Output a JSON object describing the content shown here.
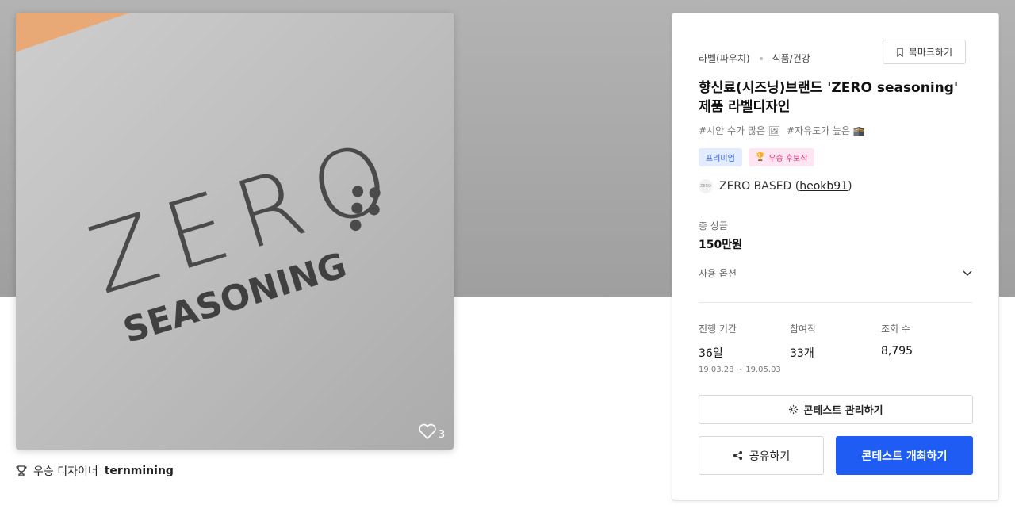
{
  "hero": {
    "logo_word": "ZERO",
    "logo_sub": "SEASONING",
    "likes": "3"
  },
  "winner": {
    "prefix": "우승 디자이너",
    "name": "ternmining"
  },
  "panel": {
    "category": "라벨(파우치)",
    "subcategory": "식품/건강",
    "bookmark_label": "북마크하기",
    "title": "향신료(시즈닝)브랜드 'ZERO seasoning' 제품 라벨디자인",
    "hashtags": [
      "#시안 수가 많은 🖼",
      "#자유도가 높은 🕋"
    ],
    "badges": {
      "premium": "프리미엄",
      "winner_icon": "🏆",
      "winner": "우승 후보작"
    },
    "host": {
      "logo_text": "ZERO",
      "name": "ZERO BASED (",
      "id": "heokb91",
      "close": ")"
    },
    "prize_label": "총 상금",
    "prize_value": "150만원",
    "options_label": "사용 옵션",
    "stats": [
      {
        "label": "진행 기간",
        "value": "36일",
        "sub": "19.03.28 ~ 19.05.03"
      },
      {
        "label": "참여작",
        "value": "33개",
        "sub": ""
      },
      {
        "label": "조회 수",
        "value": "8,795",
        "sub": ""
      }
    ],
    "manage_button": "콘테스트 관리하기",
    "share_button": "공유하기",
    "host_button": "콘테스트 개최하기"
  },
  "colors": {
    "primary": "#1f5cf4",
    "premium_bg": "#e3ecff",
    "winner_badge_bg": "#fde6f1"
  }
}
